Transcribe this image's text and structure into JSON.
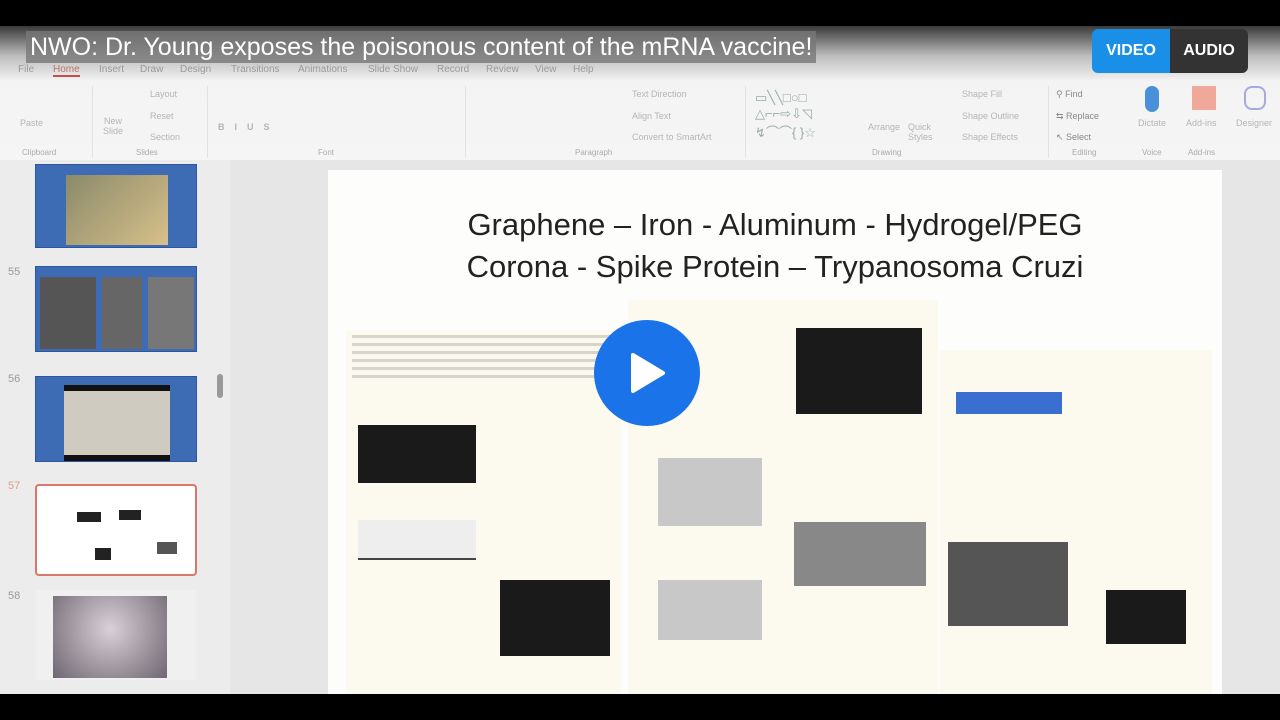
{
  "video": {
    "title": "NWO: Dr. Young exposes the poisonous content of the mRNA vaccine!",
    "mode_video": "VIDEO",
    "mode_audio": "AUDIO",
    "accent": "#1a8fe8"
  },
  "ribbon": {
    "tabs": [
      "File",
      "Home",
      "Insert",
      "Draw",
      "Design",
      "Transitions",
      "Animations",
      "Slide Show",
      "Record",
      "Review",
      "View",
      "Help"
    ],
    "clipboard": {
      "paste": "Paste",
      "group": "Clipboard"
    },
    "slides": {
      "new_slide": "New Slide",
      "layout": "Layout",
      "reset": "Reset",
      "section": "Section",
      "group": "Slides"
    },
    "font": {
      "group": "Font"
    },
    "paragraph": {
      "text_direction": "Text Direction",
      "align_text": "Align Text",
      "convert": "Convert to SmartArt",
      "group": "Paragraph"
    },
    "drawing": {
      "arrange": "Arrange",
      "quick_styles": "Quick Styles",
      "shape_fill": "Shape Fill",
      "shape_outline": "Shape Outline",
      "shape_effects": "Shape Effects",
      "group": "Drawing"
    },
    "editing": {
      "find": "Find",
      "replace": "Replace",
      "select": "Select",
      "group": "Editing"
    },
    "voice": {
      "dictate": "Dictate",
      "group": "Voice"
    },
    "addins": {
      "label": "Add-ins",
      "group": "Add-ins"
    },
    "designer": {
      "label": "Designer"
    }
  },
  "slide_panel": {
    "numbers": [
      "55",
      "56",
      "57",
      "58"
    ],
    "selected": "57"
  },
  "slide": {
    "title_line1": "Graphene – Iron - Aluminum -  Hydrogel/PEG",
    "title_line2": "Corona  - Spike Protein – Trypanosoma Cruzi"
  }
}
